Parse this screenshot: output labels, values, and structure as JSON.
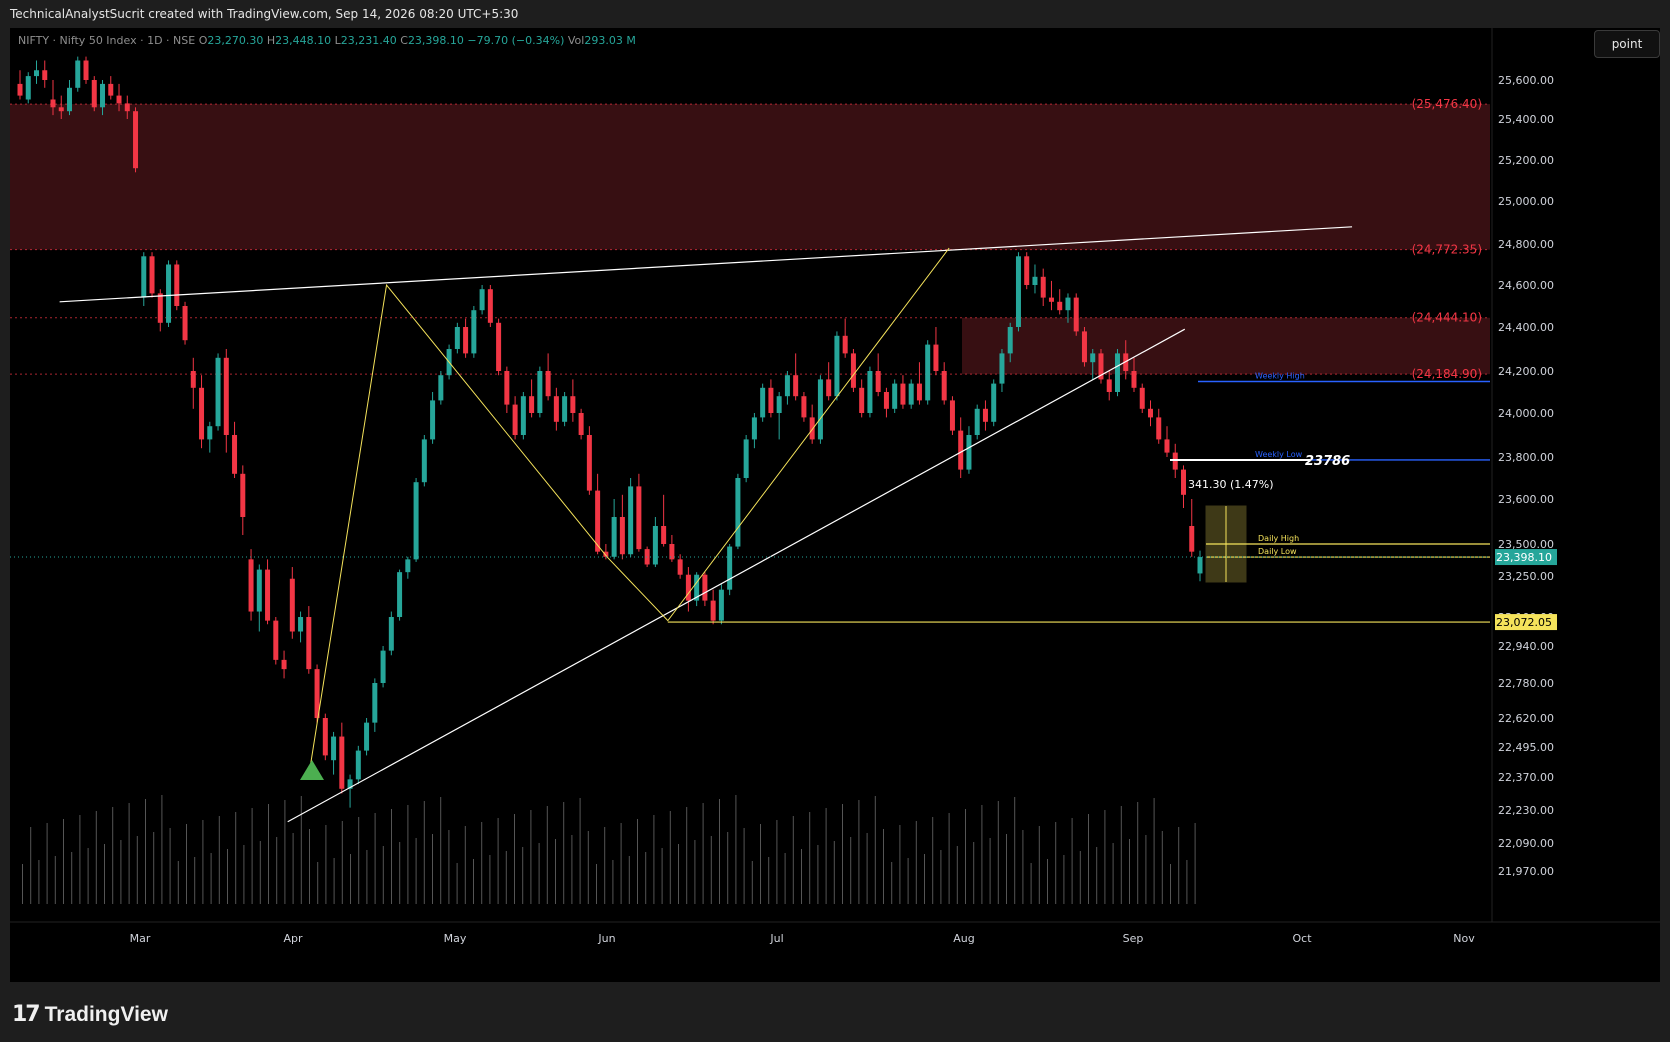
{
  "header": {
    "credit": "TechnicalAnalystSucrit created with TradingView.com, Sep 14, 2026 08:20 UTC+5:30"
  },
  "legend": {
    "symbol": "NIFTY · Nifty 50 Index · 1D · NSE",
    "o_label": "O",
    "o": "23,270.30",
    "h_label": "H",
    "h": "23,448.10",
    "l_label": "L",
    "l": "23,231.40",
    "c_label": "C",
    "c": "23,398.10",
    "change": "−79.70 (−0.34%)",
    "vol_label": "Vol",
    "vol": "293.03 M"
  },
  "toolbar": {
    "point_label": "point"
  },
  "footer": {
    "brand": "TradingView"
  },
  "colors": {
    "up": "#26a69a",
    "down": "#f23645",
    "zone": "#4a1418",
    "trend": "#ffffff",
    "wave": "#f5e35b",
    "weekly": "#2962ff",
    "daily": "#f5e35b"
  },
  "chart_data": {
    "type": "candlestick",
    "x_tick_labels": [
      "Mar",
      "Apr",
      "May",
      "Jun",
      "Jul",
      "Aug",
      "Sep",
      "Oct",
      "Nov"
    ],
    "y_tick_labels": [
      "25,600.00",
      "25,400.00",
      "25,200.00",
      "25,000.00",
      "24,800.00",
      "24,600.00",
      "24,400.00",
      "24,200.00",
      "24,000.00",
      "23,800.00",
      "23,600.00",
      "23,500.00",
      "23,250.00",
      "23,100.00",
      "22,940.00",
      "22,780.00",
      "22,620.00",
      "22,495.00",
      "22,370.00",
      "22,230.00",
      "22,090.00",
      "21,970.00"
    ],
    "last_price_label": "23,398.10",
    "support_label": "23,072.05",
    "support_value": 23072.05,
    "zones": [
      {
        "label": "(25,476.40)",
        "top": 25476.4,
        "bottom": 24772.35
      },
      {
        "label": "(24,772.35)",
        "value": 24772.35
      },
      {
        "label": "(24,444.10)",
        "top": 24444.1,
        "bottom": 24184.9
      },
      {
        "label": "(24,184.90)",
        "value": 24184.9
      }
    ],
    "levels": [
      {
        "label": "Weekly High",
        "value": 24150
      },
      {
        "label": "Weekly Low",
        "value": 23786
      },
      {
        "label": "Daily High",
        "value": 23500
      },
      {
        "label": "Daily Low",
        "value": 23398
      }
    ],
    "weekly_low_value_label": "23786",
    "measure_label": "341.30 (1.47%)",
    "candles": [
      [
        25580,
        25650,
        25500,
        25520
      ],
      [
        25500,
        25640,
        25480,
        25620
      ],
      [
        25620,
        25700,
        25580,
        25650
      ],
      [
        25650,
        25700,
        25560,
        25600
      ],
      [
        25500,
        25600,
        25420,
        25460
      ],
      [
        25460,
        25520,
        25400,
        25440
      ],
      [
        25440,
        25600,
        25420,
        25560
      ],
      [
        25560,
        25720,
        25540,
        25700
      ],
      [
        25700,
        25720,
        25580,
        25600
      ],
      [
        25600,
        25620,
        25440,
        25460
      ],
      [
        25460,
        25600,
        25420,
        25580
      ],
      [
        25580,
        25620,
        25500,
        25520
      ],
      [
        25520,
        25580,
        25440,
        25480
      ],
      [
        25480,
        25520,
        25400,
        25440
      ],
      [
        25440,
        25460,
        25140,
        25160
      ],
      [
        24540,
        24760,
        24500,
        24740
      ],
      [
        24740,
        24760,
        24540,
        24560
      ],
      [
        24560,
        24580,
        24380,
        24420
      ],
      [
        24420,
        24720,
        24400,
        24700
      ],
      [
        24700,
        24720,
        24480,
        24500
      ],
      [
        24500,
        24520,
        24320,
        24340
      ],
      [
        24200,
        24260,
        24020,
        24120
      ],
      [
        24120,
        24180,
        23840,
        23880
      ],
      [
        23880,
        23960,
        23820,
        23940
      ],
      [
        23940,
        24280,
        23920,
        24260
      ],
      [
        24260,
        24300,
        23820,
        23900
      ],
      [
        23900,
        23960,
        23700,
        23720
      ],
      [
        23720,
        23760,
        23520,
        23560
      ],
      [
        23380,
        23460,
        23080,
        23120
      ],
      [
        23120,
        23340,
        23020,
        23300
      ],
      [
        23300,
        23380,
        23060,
        23080
      ],
      [
        23080,
        23100,
        22860,
        22880
      ],
      [
        22880,
        22920,
        22800,
        22840
      ],
      [
        23240,
        23320,
        22980,
        23020
      ],
      [
        23020,
        23120,
        22960,
        23100
      ],
      [
        23100,
        23140,
        22820,
        22840
      ],
      [
        22840,
        22860,
        22600,
        22620
      ],
      [
        22620,
        22640,
        22440,
        22460
      ],
      [
        22440,
        22560,
        22380,
        22540
      ],
      [
        22540,
        22600,
        22300,
        22320
      ],
      [
        22320,
        22380,
        22240,
        22360
      ],
      [
        22360,
        22500,
        22340,
        22480
      ],
      [
        22480,
        22620,
        22460,
        22600
      ],
      [
        22600,
        22800,
        22560,
        22780
      ],
      [
        22780,
        22940,
        22760,
        22920
      ],
      [
        22920,
        23120,
        22900,
        23100
      ],
      [
        23100,
        23300,
        23080,
        23280
      ],
      [
        23280,
        23400,
        23240,
        23380
      ],
      [
        23380,
        23700,
        23360,
        23680
      ],
      [
        23680,
        23900,
        23660,
        23880
      ],
      [
        23880,
        24100,
        23860,
        24060
      ],
      [
        24060,
        24200,
        24040,
        24180
      ],
      [
        24180,
        24320,
        24160,
        24300
      ],
      [
        24300,
        24420,
        24280,
        24400
      ],
      [
        24400,
        24440,
        24260,
        24280
      ],
      [
        24280,
        24500,
        24260,
        24480
      ],
      [
        24480,
        24600,
        24460,
        24580
      ],
      [
        24580,
        24600,
        24400,
        24420
      ],
      [
        24420,
        24440,
        24180,
        24200
      ],
      [
        24200,
        24220,
        24000,
        24040
      ],
      [
        24040,
        24080,
        23880,
        23900
      ],
      [
        23900,
        24100,
        23880,
        24080
      ],
      [
        24080,
        24160,
        23980,
        24000
      ],
      [
        24000,
        24220,
        23980,
        24200
      ],
      [
        24200,
        24280,
        24060,
        24080
      ],
      [
        24080,
        24120,
        23920,
        23960
      ],
      [
        23960,
        24100,
        23940,
        24080
      ],
      [
        24080,
        24160,
        23960,
        24000
      ],
      [
        24000,
        24020,
        23880,
        23900
      ],
      [
        23900,
        23940,
        23620,
        23640
      ],
      [
        23640,
        23720,
        23420,
        23440
      ],
      [
        23440,
        23500,
        23380,
        23400
      ],
      [
        23400,
        23600,
        23380,
        23560
      ],
      [
        23560,
        23620,
        23380,
        23420
      ],
      [
        23420,
        23700,
        23400,
        23660
      ],
      [
        23660,
        23720,
        23440,
        23460
      ],
      [
        23460,
        23480,
        23320,
        23340
      ],
      [
        23340,
        23560,
        23320,
        23540
      ],
      [
        23540,
        23620,
        23480,
        23500
      ],
      [
        23500,
        23520,
        23360,
        23380
      ],
      [
        23380,
        23420,
        23240,
        23260
      ],
      [
        23260,
        23320,
        23120,
        23160
      ],
      [
        23160,
        23280,
        23140,
        23260
      ],
      [
        23260,
        23280,
        23140,
        23160
      ],
      [
        23160,
        23200,
        23060,
        23080
      ],
      [
        23080,
        23220,
        23060,
        23200
      ],
      [
        23200,
        23500,
        23180,
        23480
      ],
      [
        23480,
        23720,
        23460,
        23700
      ],
      [
        23700,
        23900,
        23680,
        23880
      ],
      [
        23880,
        24000,
        23840,
        23980
      ],
      [
        23980,
        24140,
        23960,
        24120
      ],
      [
        24120,
        24160,
        23980,
        24000
      ],
      [
        24000,
        24100,
        23880,
        24080
      ],
      [
        24080,
        24200,
        24040,
        24180
      ],
      [
        24180,
        24280,
        24060,
        24080
      ],
      [
        24080,
        24100,
        23960,
        23980
      ],
      [
        23980,
        24040,
        23860,
        23880
      ],
      [
        23880,
        24180,
        23860,
        24160
      ],
      [
        24160,
        24240,
        24060,
        24080
      ],
      [
        24080,
        24380,
        24060,
        24360
      ],
      [
        24360,
        24440,
        24260,
        24280
      ],
      [
        24280,
        24300,
        24100,
        24120
      ],
      [
        24120,
        24160,
        23980,
        24000
      ],
      [
        24000,
        24220,
        23980,
        24200
      ],
      [
        24200,
        24280,
        24080,
        24100
      ],
      [
        24100,
        24120,
        23980,
        24020
      ],
      [
        24020,
        24160,
        24000,
        24140
      ],
      [
        24140,
        24180,
        24020,
        24040
      ],
      [
        24040,
        24160,
        24020,
        24140
      ],
      [
        24140,
        24240,
        24040,
        24060
      ],
      [
        24060,
        24340,
        24040,
        24320
      ],
      [
        24320,
        24400,
        24180,
        24200
      ],
      [
        24200,
        24240,
        24040,
        24060
      ],
      [
        24060,
        24080,
        23900,
        23920
      ],
      [
        23920,
        23980,
        23700,
        23740
      ],
      [
        23740,
        23940,
        23720,
        23900
      ],
      [
        23900,
        24040,
        23880,
        24020
      ],
      [
        24020,
        24060,
        23920,
        23960
      ],
      [
        23960,
        24160,
        23940,
        24140
      ],
      [
        24140,
        24300,
        24100,
        24280
      ],
      [
        24280,
        24420,
        24240,
        24400
      ],
      [
        24400,
        24760,
        24380,
        24740
      ],
      [
        24740,
        24760,
        24580,
        24600
      ],
      [
        24600,
        24700,
        24560,
        24640
      ],
      [
        24640,
        24680,
        24500,
        24540
      ],
      [
        24540,
        24620,
        24480,
        24520
      ],
      [
        24520,
        24580,
        24460,
        24480
      ],
      [
        24480,
        24560,
        24420,
        24540
      ],
      [
        24540,
        24560,
        24360,
        24380
      ],
      [
        24380,
        24400,
        24220,
        24240
      ],
      [
        24240,
        24300,
        24160,
        24280
      ],
      [
        24280,
        24300,
        24140,
        24160
      ],
      [
        24160,
        24200,
        24060,
        24100
      ],
      [
        24100,
        24300,
        24080,
        24280
      ],
      [
        24280,
        24340,
        24160,
        24200
      ],
      [
        24200,
        24260,
        24100,
        24120
      ],
      [
        24120,
        24140,
        24000,
        24020
      ],
      [
        24020,
        24060,
        23940,
        23980
      ],
      [
        23980,
        24020,
        23860,
        23880
      ],
      [
        23880,
        23940,
        23800,
        23820
      ],
      [
        23820,
        23860,
        23700,
        23740
      ],
      [
        23740,
        23760,
        23580,
        23620
      ],
      [
        23540,
        23600,
        23400,
        23440
      ],
      [
        23270,
        23448,
        23231,
        23398
      ]
    ],
    "trendlines": [
      {
        "name": "upper-trendline",
        "from": [
          0.03,
          24520
        ],
        "to": [
          0.88,
          24880
        ]
      },
      {
        "name": "lower-trendline",
        "from": [
          0.18,
          22180
        ],
        "to": [
          0.77,
          24390
        ]
      }
    ],
    "wave_path": [
      [
        0.195,
        22420
      ],
      [
        0.245,
        24600
      ],
      [
        0.39,
        23400
      ],
      [
        0.43,
        23080
      ],
      [
        0.615,
        24780
      ]
    ]
  }
}
